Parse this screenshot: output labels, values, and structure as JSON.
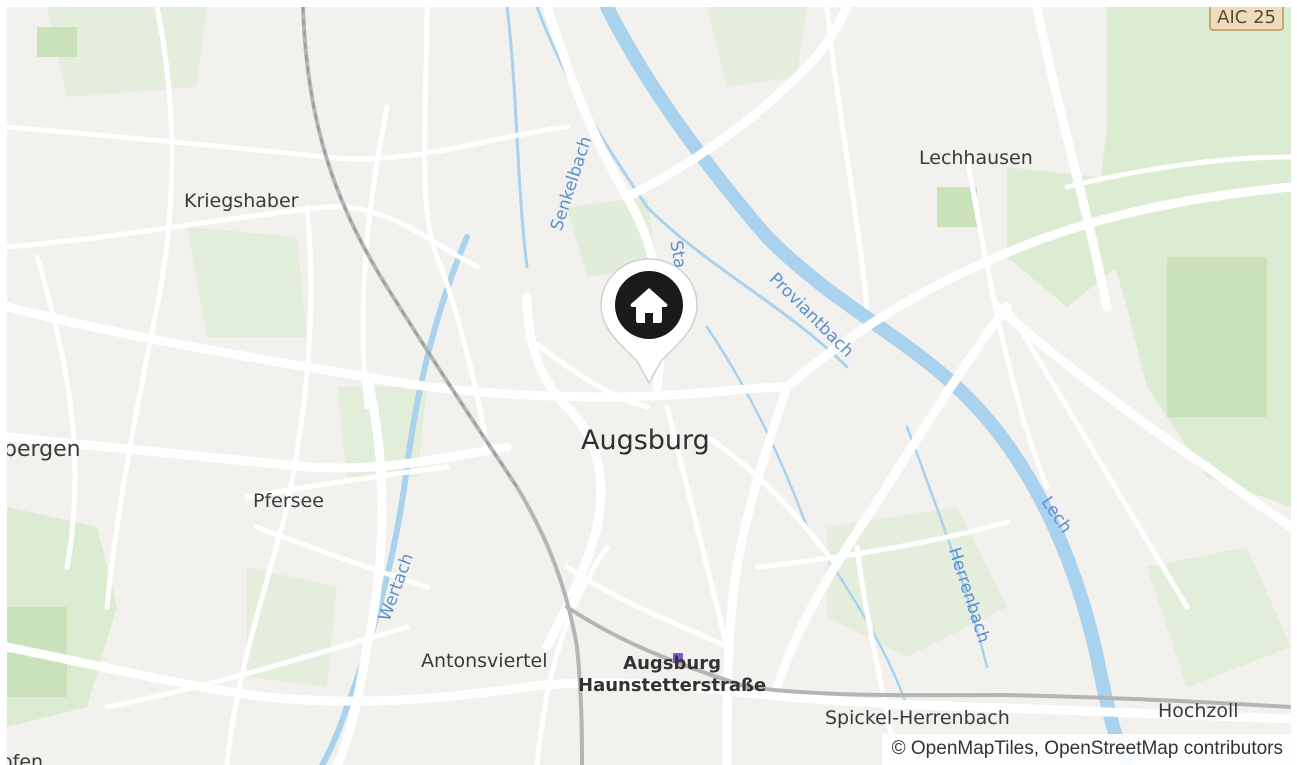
{
  "map": {
    "city_label": "Augsburg",
    "places": {
      "lechhausen": "Lechhausen",
      "kriegshaber": "Kriegshaber",
      "pfersee": "Pfersee",
      "stadtbergen_partial": "pergen",
      "antonsviertel": "Antonsviertel",
      "spickel": "Spickel-Herrenbach",
      "hochzoll": "Hochzoll",
      "bottom_left_partial": "ofen"
    },
    "station": {
      "line1": "Augsburg",
      "line2": "Haunstetterstraße"
    },
    "waterways": {
      "senkelbach": "Senkelbach",
      "stadtbach_partial": "Sta",
      "proviantbach": "Proviantbach",
      "lech": "Lech",
      "herrenbach": "Herrenbach",
      "wertach": "Wertach"
    },
    "road_shield": "AIC 25",
    "attribution": "© OpenMapTiles, OpenStreetMap contributors",
    "marker_icon": "home-icon"
  },
  "colors": {
    "land": "#f3f1ee",
    "green": "#d9ebcf",
    "water": "#a9d2ef",
    "road": "#ffffff",
    "rail": "#b5b5b5",
    "marker": "#1a1a1a"
  }
}
